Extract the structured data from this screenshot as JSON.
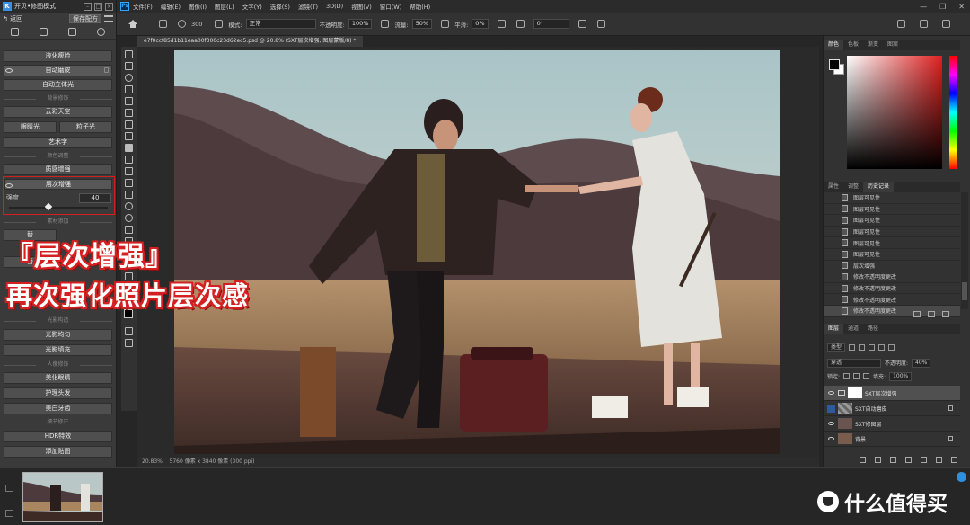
{
  "plugin": {
    "title": "开贝•修图模式",
    "back_label": "返回",
    "save_label": "保存配方",
    "buttons": {
      "liquify": "液化瘦脸",
      "auto_skin": "自动磨皮",
      "auto_3d": "自动立体光",
      "sky": "云彩天空",
      "eye_light": "眼睛光",
      "particle": "粒子光",
      "art_text": "艺术字",
      "texture": "质感增强",
      "layer_enhance": "层次增强",
      "light_even": "光影均匀",
      "light_fill": "光影填充",
      "beautify_teeth": "美化眼睛",
      "hair": "护理头发",
      "whiten": "美白牙齿",
      "hdr": "HDR特效",
      "add_pic": "添加贴图",
      "extra1": "替",
      "extra2": "替"
    },
    "sections": {
      "bg": "背景修饰",
      "color": "颜色调整",
      "material": "素材添加",
      "light": "光影构造",
      "portrait": "人像修饰",
      "detail": "细节修正"
    },
    "strength_label": "强度",
    "strength_value": "40",
    "strength_fraction": 0.4
  },
  "menubar": {
    "items": [
      "文件(F)",
      "编辑(E)",
      "图像(I)",
      "图层(L)",
      "文字(Y)",
      "选择(S)",
      "滤镜(T)",
      "3D(D)",
      "视图(V)",
      "窗口(W)",
      "帮助(H)"
    ]
  },
  "options": {
    "brush_size": "300",
    "mode_label": "模式:",
    "mode_value": "正常",
    "opacity_label": "不透明度:",
    "opacity_value": "100%",
    "flow_label": "流量:",
    "flow_value": "50%",
    "smooth_label": "平滑:",
    "smooth_value": "0%",
    "angle_value": "0°"
  },
  "document": {
    "tab": "e7f0ccf85d1b11eaa00f300c23d62ec5.psd @ 20.8% (SXT层次增强, 图层蒙版/8) *",
    "status_zoom": "20.83%",
    "status_info": "5760 像素 x 3840 像素 (300 ppi)"
  },
  "overlay": {
    "line1": "『层次增强』",
    "line2": "再次强化照片层次感"
  },
  "color_panel": {
    "tabs": [
      "颜色",
      "色板",
      "渐变",
      "图案"
    ]
  },
  "history_panel": {
    "tabs": [
      "属性",
      "调整",
      "历史记录"
    ],
    "items": [
      "图层可见性",
      "图层可见性",
      "图层可见性",
      "图层可见性",
      "图层可见性",
      "图层可见性",
      "层次增强",
      "修改不透明度更改",
      "修改不透明度更改",
      "修改不透明度更改",
      "修改不透明度更改"
    ]
  },
  "layers_panel": {
    "tabs": [
      "图层",
      "通道",
      "路径"
    ],
    "kind_label": "类型",
    "blend_value": "穿透",
    "opacity_label": "不透明度:",
    "opacity_value": "40%",
    "lock_label": "锁定:",
    "fill_label": "填充:",
    "fill_value": "100%",
    "layers": [
      {
        "name": "SXT层次增强"
      },
      {
        "name": "SXT自动磨皮"
      },
      {
        "name": "SXT修图层"
      },
      {
        "name": "背景"
      }
    ]
  },
  "watermark": "什么值得买"
}
